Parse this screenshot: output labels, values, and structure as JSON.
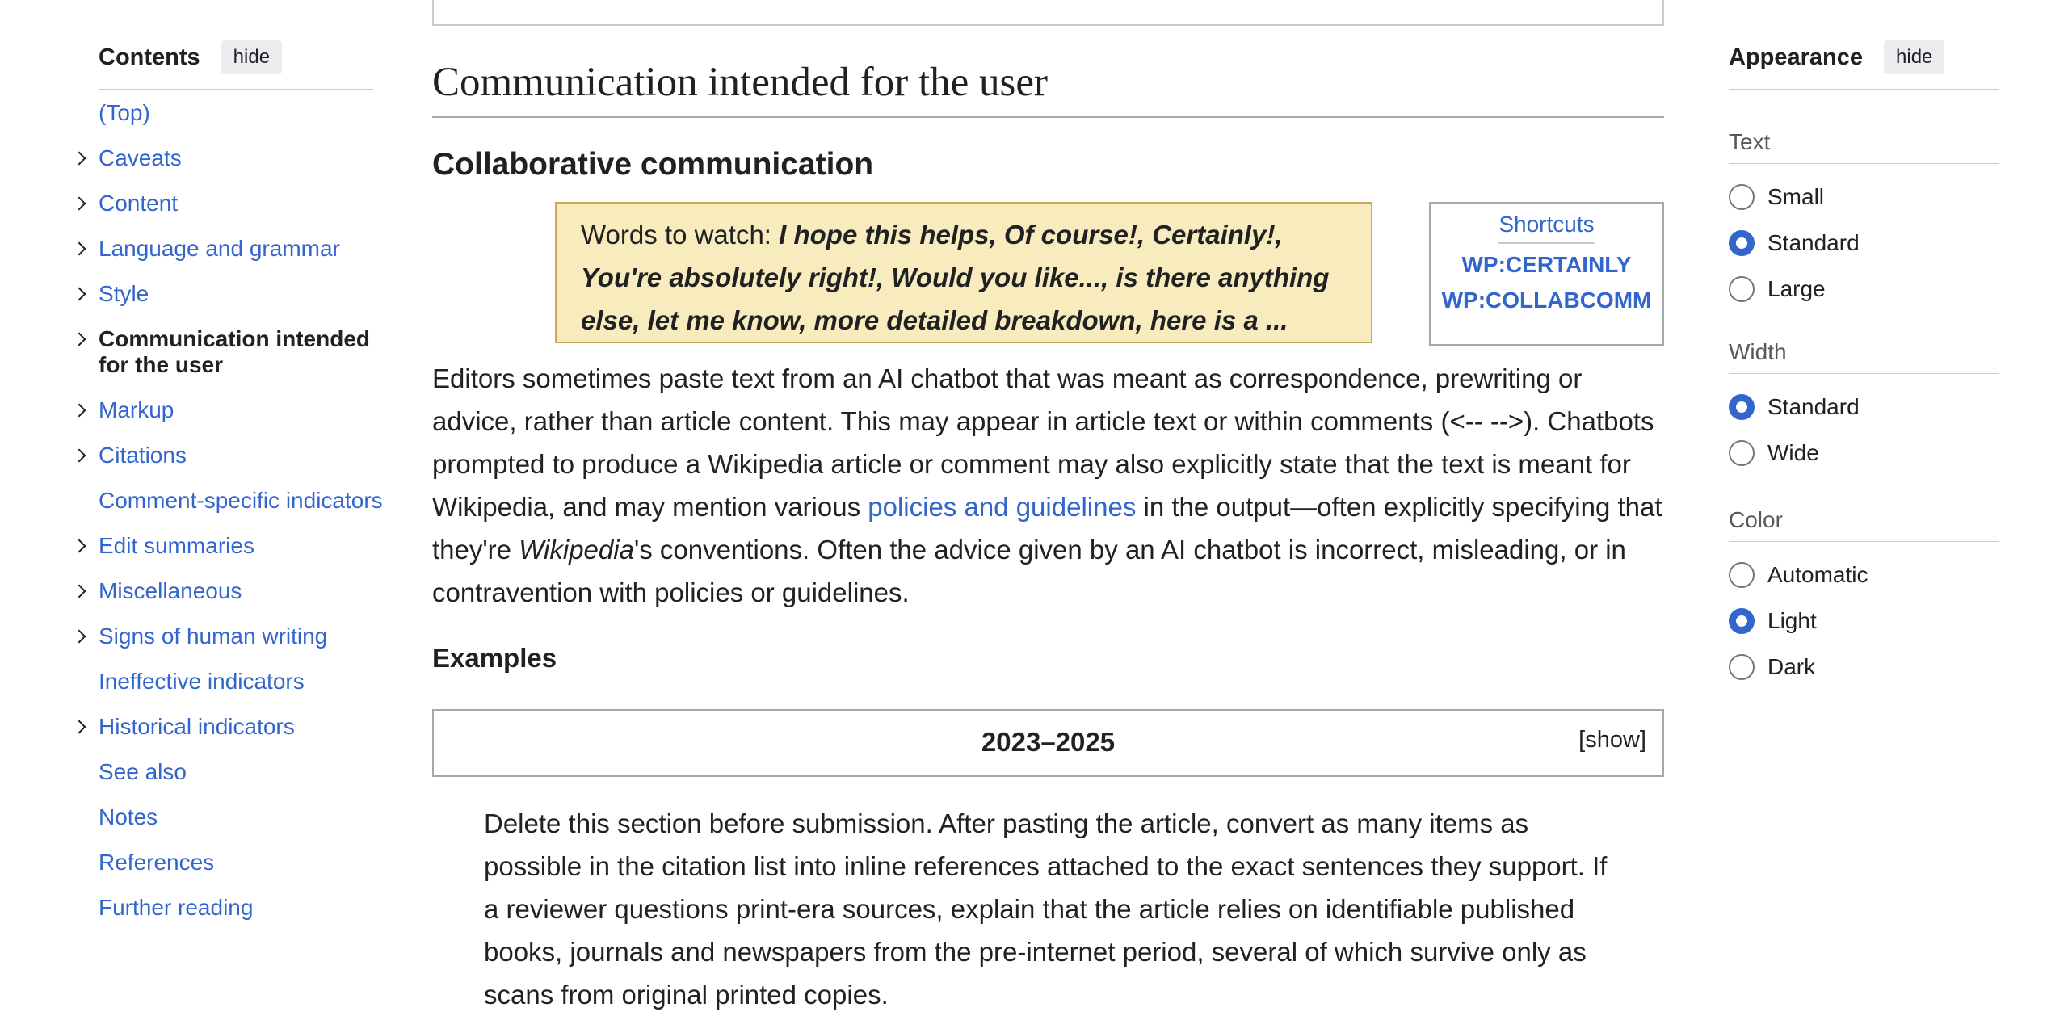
{
  "toc": {
    "title": "Contents",
    "hide_label": "hide",
    "items": [
      {
        "label": "(Top)",
        "expandable": false,
        "active": false
      },
      {
        "label": "Caveats",
        "expandable": true,
        "active": false
      },
      {
        "label": "Content",
        "expandable": true,
        "active": false
      },
      {
        "label": "Language and grammar",
        "expandable": true,
        "active": false
      },
      {
        "label": "Style",
        "expandable": true,
        "active": false
      },
      {
        "label": "Communication intended for the user",
        "expandable": true,
        "active": true
      },
      {
        "label": "Markup",
        "expandable": true,
        "active": false
      },
      {
        "label": "Citations",
        "expandable": true,
        "active": false
      },
      {
        "label": "Comment-specific indicators",
        "expandable": false,
        "active": false
      },
      {
        "label": "Edit summaries",
        "expandable": true,
        "active": false
      },
      {
        "label": "Miscellaneous",
        "expandable": true,
        "active": false
      },
      {
        "label": "Signs of human writing",
        "expandable": true,
        "active": false
      },
      {
        "label": "Ineffective indicators",
        "expandable": false,
        "active": false
      },
      {
        "label": "Historical indicators",
        "expandable": true,
        "active": false
      },
      {
        "label": "See also",
        "expandable": false,
        "active": false
      },
      {
        "label": "Notes",
        "expandable": false,
        "active": false
      },
      {
        "label": "References",
        "expandable": false,
        "active": false
      },
      {
        "label": "Further reading",
        "expandable": false,
        "active": false
      }
    ]
  },
  "main": {
    "section_title": "Communication intended for the user",
    "subsection_title": "Collaborative communication",
    "words_to_watch": {
      "prefix": "Words to watch: ",
      "terms": "I hope this helps, Of course!, Certainly!, You're absolutely right!, Would you like..., is there anything else, let me know, more detailed breakdown, here is a ..."
    },
    "shortcuts": {
      "title": "Shortcuts",
      "links": [
        "WP:CERTAINLY",
        "WP:COLLABCOMM"
      ]
    },
    "paragraph": {
      "part1": "Editors sometimes paste text from an AI chatbot that was meant as correspondence, prewriting or advice, rather than article content. This may appear in article text or within comments (<-- -->). Chatbots prompted to produce a Wikipedia article or comment may also explicitly state that the text is meant for Wikipedia, and may mention various ",
      "link": "policies and guidelines",
      "part2": " in the output—often explicitly specifying that they're ",
      "italic": "Wikipedia",
      "part3": "'s conventions. Often the advice given by an AI chatbot is incorrect, misleading, or in contravention with policies or guidelines."
    },
    "examples_heading": "Examples",
    "collapse": {
      "title": "2023–2025",
      "toggle": "[show]"
    },
    "quote": "Delete this section before submission. After pasting the article, convert as many items as possible in the citation list into inline references attached to the exact sentences they support. If a reviewer questions print-era sources, explain that the article relies on identifiable published books, journals and newspapers from the pre-internet period, several of which survive only as scans from original printed copies."
  },
  "appearance": {
    "title": "Appearance",
    "hide_label": "hide",
    "groups": [
      {
        "label": "Text",
        "options": [
          "Small",
          "Standard",
          "Large"
        ],
        "selected": "Standard"
      },
      {
        "label": "Width",
        "options": [
          "Standard",
          "Wide"
        ],
        "selected": "Standard"
      },
      {
        "label": "Color",
        "options": [
          "Automatic",
          "Light",
          "Dark"
        ],
        "selected": "Light"
      }
    ]
  },
  "colors": {
    "link": "#3366cc",
    "text": "#202122",
    "watch_box_bg": "#f8ebbd",
    "radio_selected": "#3366cc"
  }
}
